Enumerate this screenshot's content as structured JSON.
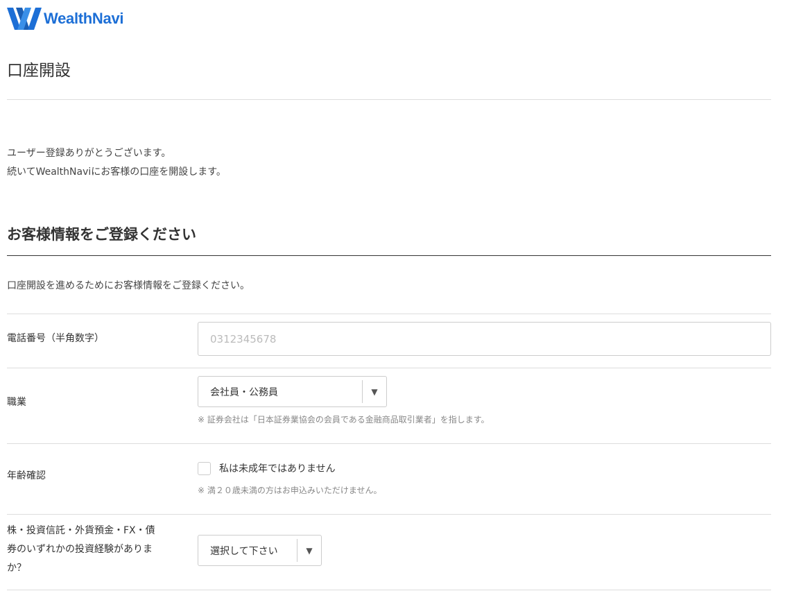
{
  "brand": {
    "name": "WealthNavi",
    "color": "#1d6fd6",
    "logo_icon": "wealthnavi-w-logo-icon"
  },
  "page": {
    "title": "口座開設"
  },
  "intro": {
    "line1": "ユーザー登録ありがとうございます。",
    "line2": "続いてWealthNaviにお客様の口座を開設します。"
  },
  "section": {
    "heading": "お客様情報をご登録ください",
    "lead": "口座開設を進めるためにお客様情報をご登録ください。"
  },
  "form": {
    "phone": {
      "label": "電話番号（半角数字）",
      "value": "",
      "placeholder": "0312345678"
    },
    "occupation": {
      "label": "職業",
      "selected": "会社員・公務員",
      "note": "※ 証券会社は「日本証券業協会の会員である金融商品取引業者」を指します。"
    },
    "age": {
      "label": "年齢確認",
      "checkbox_label": "私は未成年ではありません",
      "checked": false,
      "note": "※ 満２０歳未満の方はお申込みいただけません。"
    },
    "experience": {
      "label_line1": "株・投資信託・外貨預金・FX・債",
      "label_line2": "券のいずれかの投資経験がありま",
      "label_line3": "か？",
      "selected": "選択して下さい"
    }
  },
  "icons": {
    "dropdown": "triangle-down-icon"
  }
}
